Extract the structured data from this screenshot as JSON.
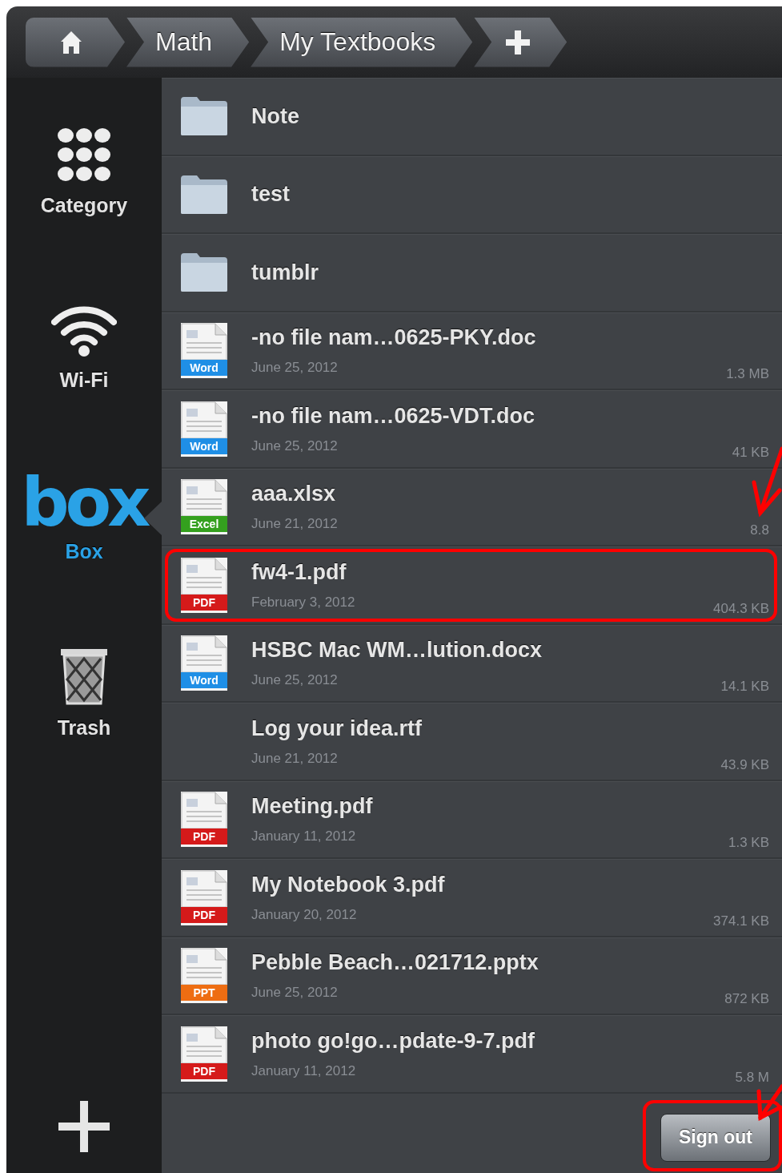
{
  "breadcrumb": [
    {
      "kind": "home"
    },
    {
      "kind": "text",
      "label": "Math"
    },
    {
      "kind": "text",
      "label": "My Textbooks"
    },
    {
      "kind": "add"
    }
  ],
  "sidebar": {
    "items": [
      {
        "kind": "category",
        "label": "Category",
        "selected": false
      },
      {
        "kind": "wifi",
        "label": "Wi-Fi",
        "selected": false
      },
      {
        "kind": "box",
        "logo": "box",
        "label": "Box",
        "selected": true
      },
      {
        "kind": "trash",
        "label": "Trash",
        "selected": false
      }
    ]
  },
  "files": [
    {
      "kind": "folder",
      "name": "Note",
      "highlighted": false
    },
    {
      "kind": "folder",
      "name": "test",
      "highlighted": false
    },
    {
      "kind": "folder",
      "name": "tumblr",
      "highlighted": false
    },
    {
      "kind": "file",
      "color": "#1f8fe6",
      "badge": "Word",
      "name": "-no file nam…0625-PKY.doc",
      "date": "June 25, 2012",
      "size": "1.3 MB",
      "highlighted": false
    },
    {
      "kind": "file",
      "color": "#1f8fe6",
      "badge": "Word",
      "name": "-no file nam…0625-VDT.doc",
      "date": "June 25, 2012",
      "size": "41 KB",
      "highlighted": false
    },
    {
      "kind": "file",
      "color": "#34a01e",
      "badge": "Excel",
      "name": "aaa.xlsx",
      "date": "June 21, 2012",
      "size": "8.8",
      "highlighted": false
    },
    {
      "kind": "file",
      "color": "#d51a1a",
      "badge": "PDF",
      "name": "fw4-1.pdf",
      "date": "February 3, 2012",
      "size": "404.3 KB",
      "highlighted": true
    },
    {
      "kind": "file",
      "color": "#1f8fe6",
      "badge": "Word",
      "name": "HSBC Mac WM…lution.docx",
      "date": "June 25, 2012",
      "size": "14.1 KB",
      "highlighted": false
    },
    {
      "kind": "file",
      "name": "Log your idea.rtf",
      "date": "June 21, 2012",
      "size": "43.9 KB",
      "highlighted": false
    },
    {
      "kind": "file",
      "color": "#d51a1a",
      "badge": "PDF",
      "name": "Meeting.pdf",
      "date": "January 11, 2012",
      "size": "1.3 KB",
      "highlighted": false
    },
    {
      "kind": "file",
      "color": "#d51a1a",
      "badge": "PDF",
      "name": "My Notebook 3.pdf",
      "date": "January 20, 2012",
      "size": "374.1 KB",
      "highlighted": false
    },
    {
      "kind": "file",
      "color": "#ee6d12",
      "badge": "PPT",
      "name": "Pebble Beach…021712.pptx",
      "date": "June 25, 2012",
      "size": "872 KB",
      "highlighted": false
    },
    {
      "kind": "file",
      "color": "#d51a1a",
      "badge": "PDF",
      "name": "photo go!go…pdate-9-7.pdf",
      "date": "January 11, 2012",
      "size": "5.8 M",
      "highlighted": false
    }
  ],
  "sign_out": {
    "label": "Sign out",
    "highlighted": true
  }
}
